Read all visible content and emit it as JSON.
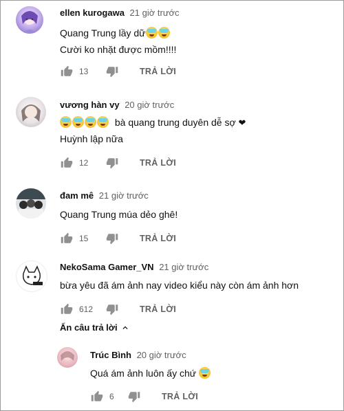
{
  "comments": [
    {
      "author": "ellen kurogawa",
      "time": "21 giờ trước",
      "line1": "Quang Trung lầy dữ",
      "line2": "Cười ko nhặt được mồm!!!!",
      "likes": "13",
      "reply_label": "TRẢ LỜI"
    },
    {
      "author": "vương hàn vy",
      "time": "20 giờ trước",
      "line1": "bà quang trung duyên dễ sợ",
      "line2": "Huỳnh lập nữa",
      "likes": "12",
      "reply_label": "TRẢ LỜI"
    },
    {
      "author": "đam mê",
      "time": "21 giờ trước",
      "line1": "Quang Trung múa dẻo ghê!",
      "likes": "15",
      "reply_label": "TRẢ LỜI"
    },
    {
      "author": "NekoSama Gamer_VN",
      "time": "21 giờ trước",
      "line1": "bừa yêu đã ám ảnh nay video kiểu này còn ám ảnh hơn",
      "likes": "612",
      "reply_label": "TRẢ LỜI"
    }
  ],
  "hide_replies_label": "Ẩn câu trả lời",
  "reply": {
    "author": "Trúc Bình",
    "time": "20 giờ trước",
    "line1": "Quá ám ảnh luôn ấy chứ",
    "likes": "6",
    "reply_label": "TRẢ LỜI"
  },
  "colors": {
    "text": "#111111",
    "secondary": "#606060",
    "icon": "#909090"
  }
}
